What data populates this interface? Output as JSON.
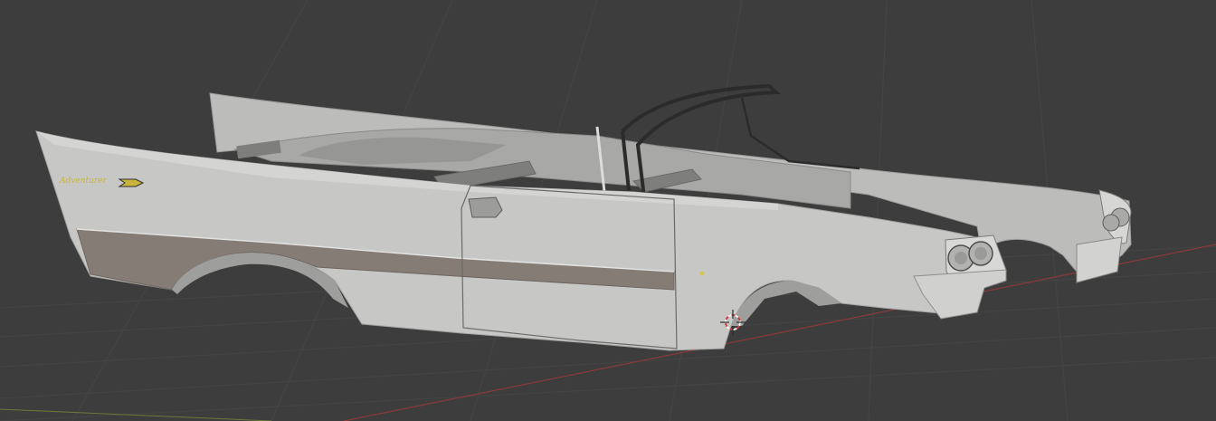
{
  "viewport": {
    "background": "#3d3d3d",
    "grid_color": "#454545",
    "x_axis_color": "#8a3a3a",
    "y_axis_color": "#6a7a3a"
  },
  "model": {
    "object": "car-body-convertible",
    "body_color": "#c7c7c5",
    "trim_color": "#857c76",
    "badge_text": "Adventurer",
    "badge_color": "#c8b43a"
  },
  "cursor": {
    "icon": "3d-cursor-icon",
    "ring_color_a": "#c84040",
    "ring_color_b": "#f0f0f0"
  }
}
